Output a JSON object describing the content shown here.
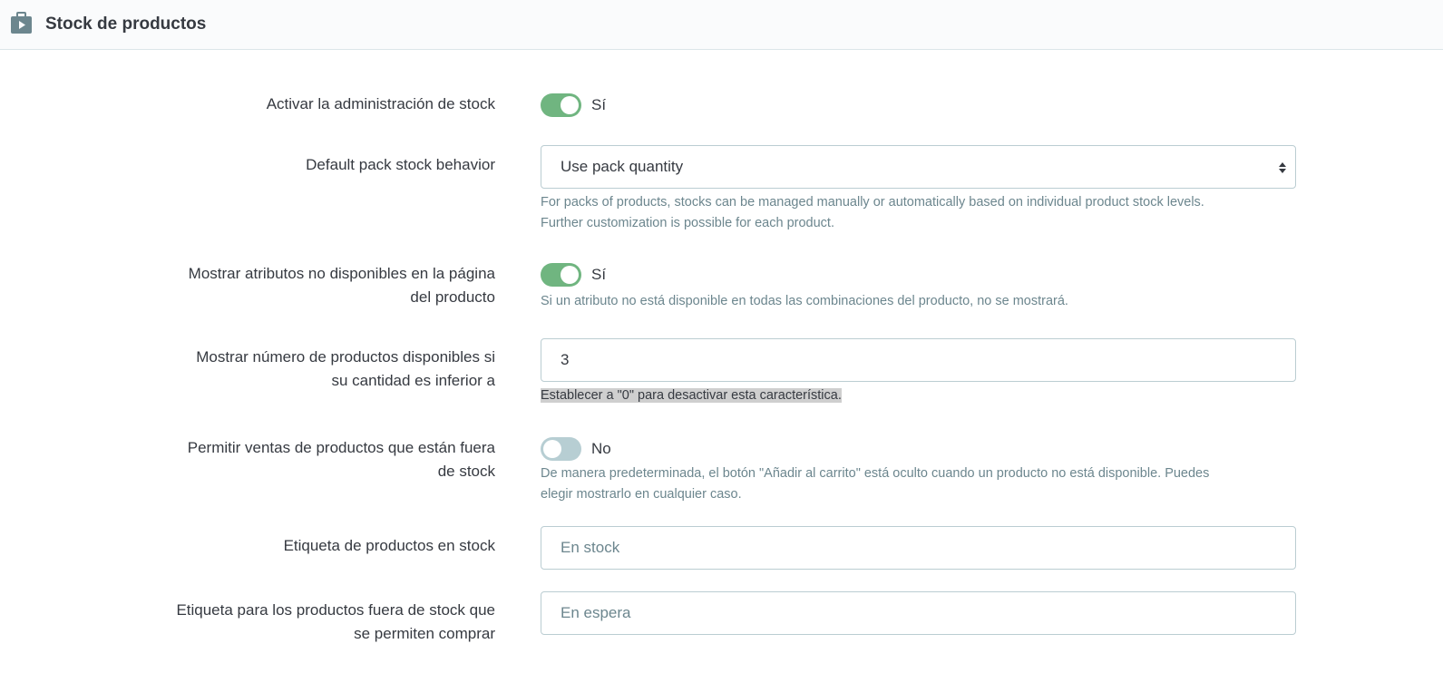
{
  "header": {
    "title": "Stock de productos",
    "icon": "briefcase-icon"
  },
  "fields": {
    "stock_management": {
      "label": "Activar la administración de stock",
      "toggle_value": "Sí",
      "enabled": true
    },
    "pack_behavior": {
      "label": "Default pack stock behavior",
      "selected": "Use pack quantity",
      "help_line1": "For packs of products, stocks can be managed manually or automatically based on individual product stock levels.",
      "help_line2": "Further customization is possible for each product."
    },
    "show_unavailable": {
      "label_line1": "Mostrar atributos no disponibles en la página",
      "label_line2": "del producto",
      "toggle_value": "Sí",
      "enabled": true,
      "help": "Si un atributo no está disponible en todas las combinaciones del producto, no se mostrará."
    },
    "display_quantity": {
      "label_line1": "Mostrar número de productos disponibles si",
      "label_line2": "su cantidad es inferior a",
      "value": "3",
      "help": "Establecer a \"0\" para desactivar esta característica."
    },
    "allow_oos": {
      "label_line1": "Permitir ventas de productos que están fuera",
      "label_line2": "de stock",
      "toggle_value": "No",
      "enabled": false,
      "help_line1": "De manera predeterminada, el botón \"Añadir al carrito\" está oculto cuando un producto no está disponible. Puedes",
      "help_line2": "elegir mostrarlo en cualquier caso."
    },
    "in_stock_label": {
      "label": "Etiqueta de productos en stock",
      "placeholder": "En stock"
    },
    "oos_allowed_label": {
      "label_line1": "Etiqueta para los productos fuera de stock que",
      "label_line2": "se permiten comprar",
      "placeholder": "En espera"
    }
  },
  "colors": {
    "toggle_on": "#70b580",
    "toggle_off": "#b7ced3",
    "border": "#bbcdd2",
    "help_text": "#6c868e"
  }
}
